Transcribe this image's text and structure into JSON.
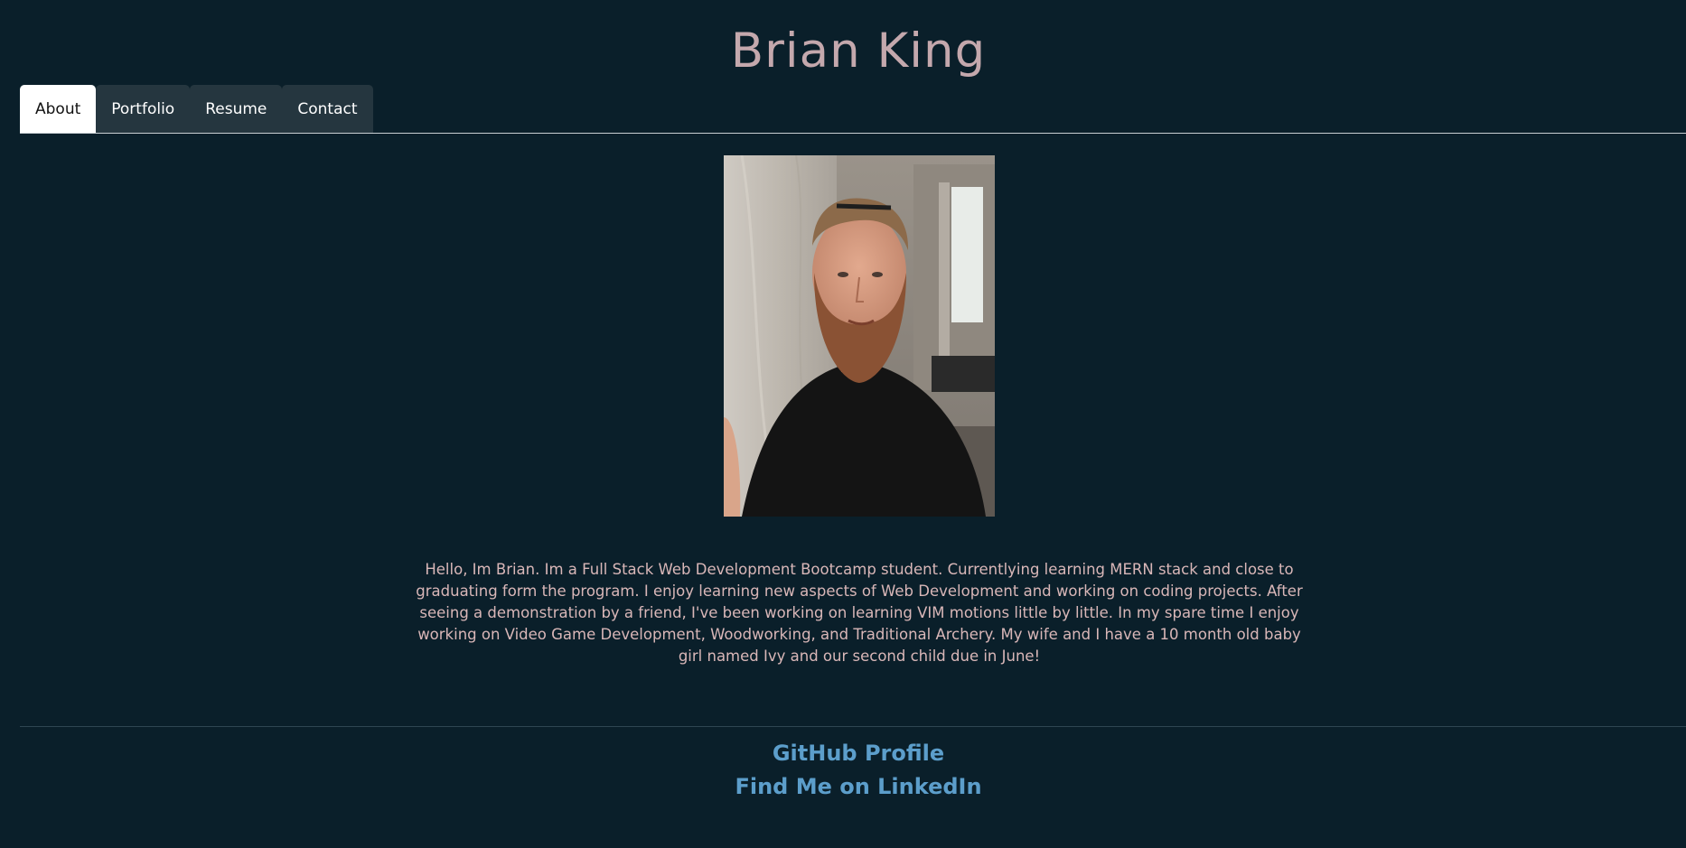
{
  "header": {
    "title": "Brian King"
  },
  "nav": {
    "tabs": [
      {
        "label": "About",
        "active": true
      },
      {
        "label": "Portfolio",
        "active": false
      },
      {
        "label": "Resume",
        "active": false
      },
      {
        "label": "Contact",
        "active": false
      }
    ]
  },
  "about": {
    "bio": "Hello, Im Brian. Im a Full Stack Web Development Bootcamp student. Currentlying learning MERN stack and close to graduating form the program. I enjoy learning new aspects of Web Development and working on coding projects. After seeing a demonstration by a friend, I've been working on learning VIM motions little by little. In my spare time I enjoy working on Video Game Development, Woodworking, and Traditional Archery. My wife and I have a 10 month old baby girl named Ivy and our second child due in June!"
  },
  "footer": {
    "github_label": "GitHub Profile",
    "linkedin_label": "Find Me on LinkedIn"
  },
  "colors": {
    "background": "#0a1f2a",
    "title": "#c4a8ad",
    "tab_inactive": "#25363f",
    "tab_active": "#ffffff",
    "bio_text": "#d9b7b8",
    "link": "#5c9ecb"
  }
}
